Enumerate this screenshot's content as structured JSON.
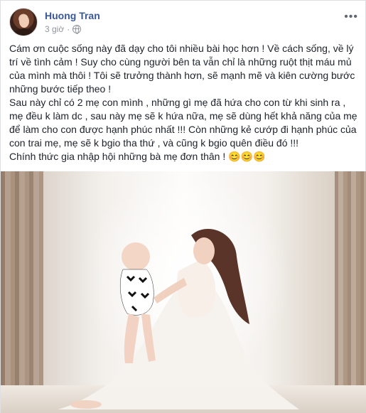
{
  "post": {
    "author_name": "Huong Tran",
    "time": "3 giờ",
    "separator": "·",
    "privacy_icon": "globe-icon",
    "more_icon": "ellipsis-icon",
    "more_label": "•••",
    "paragraphs": [
      "Cám ơn cuộc sống này đã dạy cho tôi nhiều bài học hơn ! Về cách sống, về lý trí về tình cảm ! Suy cho cùng người bên ta vẫn chỉ là những ruột thịt máu mủ của mình mà thôi ! Tôi sẽ trưởng thành hơn, sẽ mạnh mẽ và kiên cường bước những bước tiếp theo !",
      "Sau này chỉ có 2 mẹ con mình , những gì mẹ đã hứa cho con từ khi sinh ra , mẹ đều k làm dc , sau này mẹ sẽ k hứa nữa, mẹ sẽ dùng hết khả năng của mẹ để làm cho con được hạnh phúc nhất !!! Còn những kẻ cướp đi hạnh phúc của con trai mẹ, mẹ sẽ k bgio tha thứ , và cũng k bgio quên điều đó !!!",
      "Chính thức gia nhập hội những bà mẹ đơn thân ! 😊😊😊"
    ]
  }
}
